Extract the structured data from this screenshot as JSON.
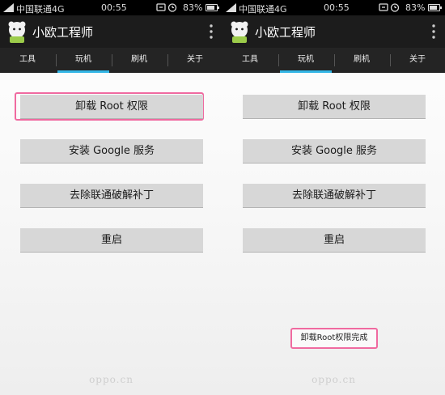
{
  "status_bar": {
    "carrier": "中国联通4G",
    "time": "00:55",
    "battery_pct": "83%",
    "battery_level": 0.83,
    "icons": [
      "signal-icon",
      "sync-icon",
      "alarm-icon",
      "battery-icon"
    ]
  },
  "app": {
    "title": "小欧工程师",
    "icons": [
      "app-logo-icon",
      "overflow-menu-icon"
    ]
  },
  "tabs": [
    {
      "label": "工具"
    },
    {
      "label": "玩机",
      "active": true
    },
    {
      "label": "刷机"
    },
    {
      "label": "关于"
    }
  ],
  "buttons": [
    {
      "label": "卸载 Root 权限"
    },
    {
      "label": "安装 Google 服务"
    },
    {
      "label": "去除联通破解补丁"
    },
    {
      "label": "重启"
    }
  ],
  "toast": {
    "text": "卸载Root权限完成"
  },
  "watermark": "oppo.cn",
  "colors": {
    "accent": "#33b5e5",
    "highlight": "#f06aa0",
    "button": "#d7d7d7",
    "bar": "#1c1c1c"
  }
}
